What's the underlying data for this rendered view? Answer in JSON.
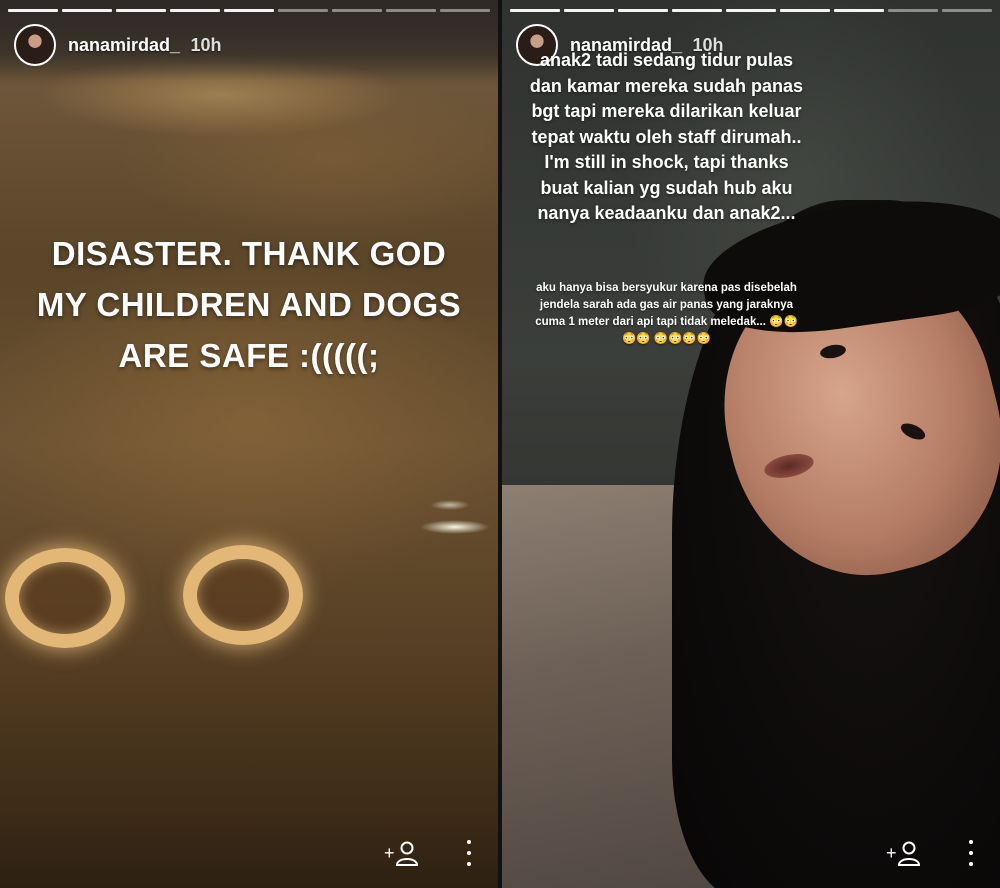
{
  "stories": [
    {
      "username": "nanamirdad_",
      "time": "10h",
      "caption_lines": [
        "DISASTER. THANK GOD",
        "MY CHILDREN AND DOGS",
        "ARE SAFE :(((((;"
      ],
      "progress": {
        "segments": 9,
        "completed": 5
      }
    },
    {
      "username": "nanamirdad_",
      "time": "10h",
      "caption_top": "anak2 tadi sedang tidur pulas dan kamar mereka sudah panas bgt tapi mereka dilarikan keluar tepat waktu oleh staff dirumah.. I'm still in shock, tapi thanks buat kalian yg sudah hub aku nanya keadaanku dan anak2...",
      "caption_small": "aku hanya bisa bersyukur karena pas disebelah jendela sarah ada gas air panas yang jaraknya cuma 1 meter dari api tapi tidak meledak... 😳😳😳😳 😳😳😳😳",
      "progress": {
        "segments": 9,
        "completed": 7
      }
    }
  ],
  "icons": {
    "follow": "add-person-icon",
    "more": "more-vertical-icon"
  }
}
